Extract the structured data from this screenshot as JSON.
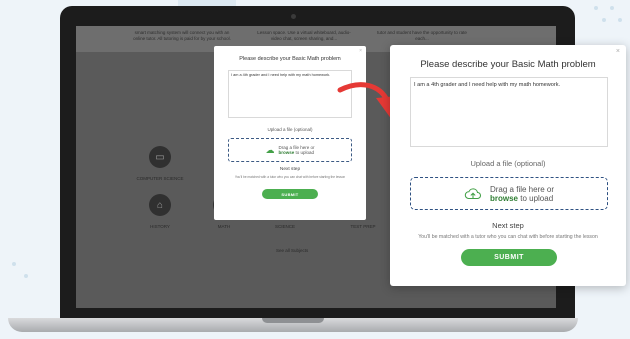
{
  "colors": {
    "accent_green": "#4caf50",
    "dropzone_border": "#2e5182",
    "arrow_red": "#e53935"
  },
  "site": {
    "top_text": [
      "smart matching system will connect you with an online tutor. All tutoring is paid for by your school.",
      "Lesson space. Use a virtual whiteboard, audio-video chat, screen sharing, and...",
      "tutor and student have the opportunity to rate each..."
    ],
    "subjects": [
      {
        "label": "COMPUTER SCIENCE",
        "icon": "monitor-icon"
      },
      {
        "label": "HISTORY",
        "icon": "history-icon"
      },
      {
        "label": "MATH",
        "icon": "math-icon"
      },
      {
        "label": "SCIENCE",
        "icon": "science-icon"
      },
      {
        "label": "TEST PREP",
        "icon": "test-prep-icon"
      }
    ],
    "see_all": "See all Subjects"
  },
  "modal": {
    "title": "Please describe your Basic Math problem",
    "problem_text": "I am a 4th grader and I need help with my math homework.",
    "upload_label": "Upload a file (optional)",
    "drop_line1": "Drag a file here or",
    "drop_browse": "browse",
    "drop_line2_rest": " to upload",
    "next_step_label": "Next step",
    "next_step_note": "You'll be matched with a tutor who you can chat with before starting the lesson",
    "submit_label": "SUBMIT",
    "close_glyph": "×"
  }
}
